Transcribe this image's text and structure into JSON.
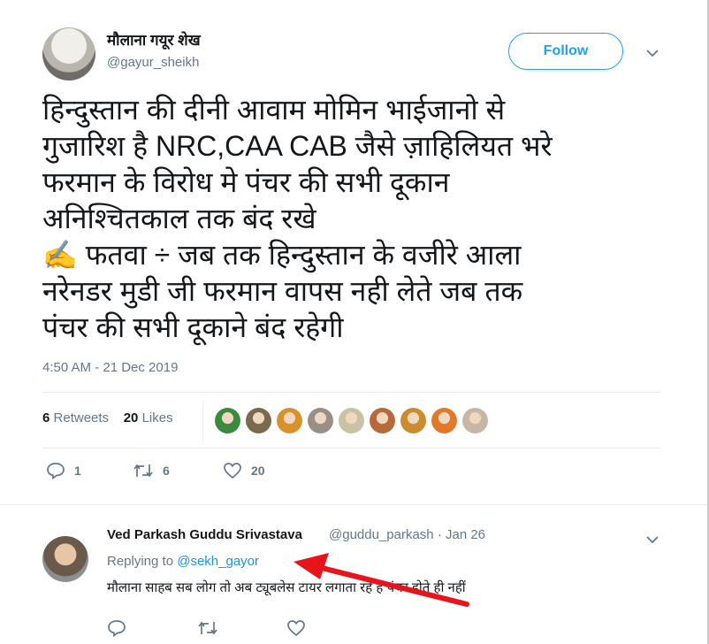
{
  "tweet": {
    "author_name": "मौलाना गयूर शेख",
    "author_handle": "@gayur_sheikh",
    "follow_label": "Follow",
    "text_lines": [
      "हिन्दुस्तान की दीनी आवाम मोमिन भाईजानो से",
      "गुजारिश है NRC,CAA CAB जैसे ज़ाहिलियत भरे",
      "फरमान के विरोध मे पंचर की सभी दूकान",
      "अनिश्चितकाल तक बंद रखे",
      "✍️ फतवा ÷ जब तक हिन्दुस्तान के वजीरे आला",
      "नरेनडर मुडी जी फरमान वापस नही लेते जब तक",
      "पंचर की सभी दूकाने बंद रहेगी"
    ],
    "timestamp": "4:50 AM - 21 Dec 2019",
    "retweets_count": "6",
    "retweets_label": "Retweets",
    "likes_count": "20",
    "likes_label": "Likes",
    "reply_count": "1",
    "retweet_action_count": "6",
    "like_action_count": "20",
    "liker_avatar_colors": [
      "#3b8a3e",
      "#7c6a4f",
      "#d9912b",
      "#9a8f86",
      "#c9c2a4",
      "#b66a3a",
      "#cc8b2f",
      "#e07a2a",
      "#c7b6a6"
    ]
  },
  "reply": {
    "author_name": "Ved Parkash Guddu Srivastava",
    "meta": "@guddu_parkash · Jan 26",
    "replying_prefix": "Replying to",
    "replying_handle": "@sekh_gayor",
    "text": "मौलाना साहब सब लोग तो अब ट्यूबलेस टायर लगाता रहे हैं पंचर होते ही नहीं"
  },
  "colors": {
    "accent": "#1da1f2",
    "muted": "#657786",
    "arrow": "#e8141c"
  }
}
